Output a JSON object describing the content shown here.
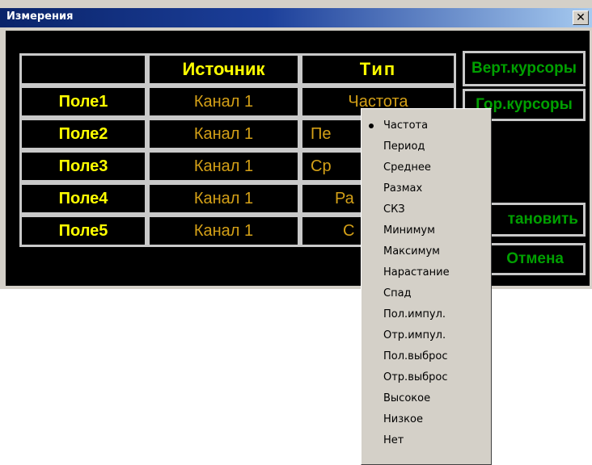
{
  "window": {
    "title": "Измерения",
    "close_glyph": "✕"
  },
  "table": {
    "headers": [
      "",
      "Источник",
      "Тип"
    ],
    "rows": [
      {
        "field": "Поле1",
        "source": "Канал 1",
        "type": "Частота"
      },
      {
        "field": "Поле2",
        "source": "Канал 1",
        "type": "Пе"
      },
      {
        "field": "Поле3",
        "source": "Канал 1",
        "type": "Ср"
      },
      {
        "field": "Поле4",
        "source": "Канал 1",
        "type": "Ра"
      },
      {
        "field": "Поле5",
        "source": "Канал 1",
        "type": "С"
      }
    ]
  },
  "buttons": {
    "vert_cursors": "Верт.курсоры",
    "hor_cursors": "Гор.курсоры",
    "set": "тановить",
    "cancel": "Отмена"
  },
  "menu": {
    "selected": "Частота",
    "items": [
      "Частота",
      "Период",
      "Среднее",
      "Размах",
      "СКЗ",
      "Минимум",
      "Максимум",
      "Нарастание",
      "Спад",
      "Пол.импул.",
      "Отр.импул.",
      "Пол.выброс",
      "Отр.выброс",
      "Высокое",
      "Низкое",
      "Нет"
    ]
  },
  "colors": {
    "label_yellow": "#ffff00",
    "value_gold": "#d4a017",
    "button_green": "#00a000",
    "background": "#000000"
  }
}
